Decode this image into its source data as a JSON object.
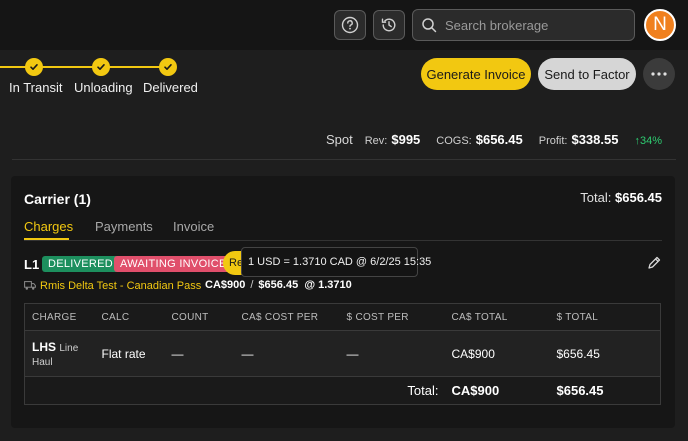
{
  "search": {
    "placeholder": "Search brokerage"
  },
  "avatar": {
    "initial": "N",
    "color": "#f0801e"
  },
  "steps": [
    {
      "label": "In Transit",
      "status": "complete"
    },
    {
      "label": "Unloading",
      "status": "complete"
    },
    {
      "label": "Delivered",
      "status": "complete"
    }
  ],
  "actions": {
    "generate_invoice": "Generate Invoice",
    "send_to_factor": "Send to Factor"
  },
  "summary": {
    "type": "Spot",
    "rev_label": "Rev:",
    "rev": "$995",
    "cogs_label": "COGS:",
    "cogs": "$656.45",
    "profit_label": "Profit:",
    "profit": "$338.55",
    "profit_pct": "↑34%"
  },
  "carrier": {
    "title": "Carrier (1)",
    "total_label": "Total:",
    "total": "$656.45",
    "tabs": [
      "Charges",
      "Payments",
      "Invoice"
    ],
    "active_tab": "Charges",
    "load": {
      "id": "L1",
      "badges": [
        "DELIVERED",
        "AWAITING INVOICE"
      ],
      "pill_text": "Re",
      "tooltip": "1 USD = 1.3710 CAD @ 6/2/25 15:35",
      "carrier_name": "Rmis Delta Test - Canadian Pass",
      "cad_amount": "CA$900",
      "separator": "/",
      "usd_amount": "$656.45",
      "rate": "@ 1.3710"
    },
    "table": {
      "headers": [
        "CHARGE",
        "CALC",
        "COUNT",
        "CA$ COST PER",
        "$ COST PER",
        "CA$ TOTAL",
        "$ TOTAL"
      ],
      "rows": [
        {
          "code": "LHS",
          "desc": "Line Haul",
          "calc": "Flat rate",
          "count": "—",
          "cad_cost_per": "—",
          "usd_cost_per": "—",
          "cad_total": "CA$900",
          "usd_total": "$656.45"
        }
      ],
      "total_label": "Total:",
      "total_cad": "CA$900",
      "total_usd": "$656.45"
    }
  },
  "colors": {
    "accent": "#f2c811",
    "positive": "#2ecc71",
    "delivered": "#1d8f5e",
    "awaiting": "#e04f6b"
  }
}
